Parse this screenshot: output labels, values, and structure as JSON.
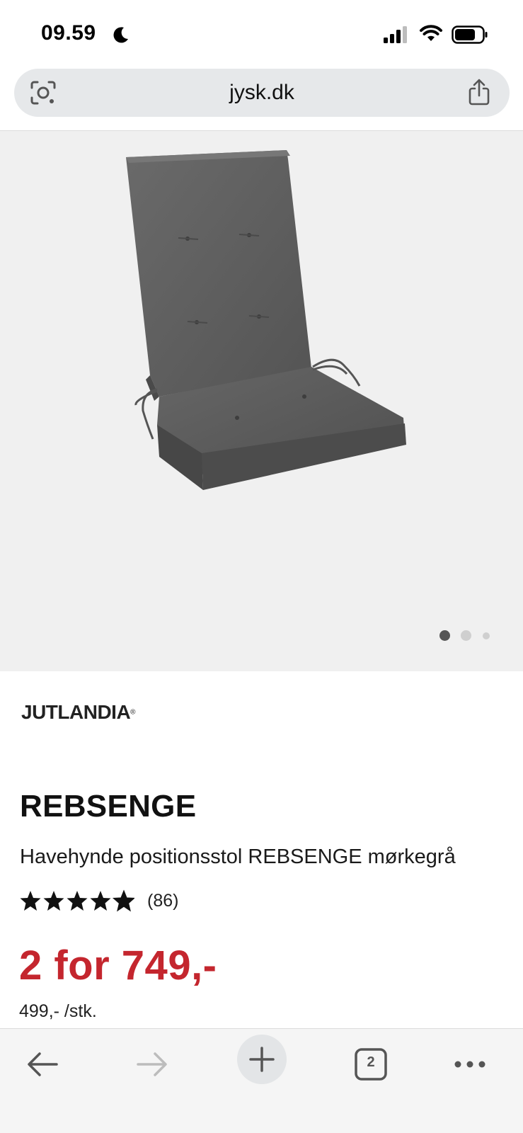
{
  "status_bar": {
    "time": "09.59"
  },
  "browser": {
    "url": "jysk.dk"
  },
  "gallery": {
    "image_alt": "Havehynde positionsstol REBSENGE mørkegrå",
    "active_dot": 1,
    "dot_count": 3
  },
  "product": {
    "brand": "JUTLANDIA",
    "name": "REBSENGE",
    "description": "Havehynde positionsstol REBSENGE mørkegrå",
    "rating_stars": 4.5,
    "review_count": "(86)",
    "price": "2 for 749,-",
    "unit_price": "499,- /stk."
  },
  "toolbar": {
    "tabs_count": "2"
  },
  "colors": {
    "price_red": "#c4262e",
    "gallery_bg": "#f0f0f0",
    "url_bar_bg": "#e6e8ea"
  }
}
